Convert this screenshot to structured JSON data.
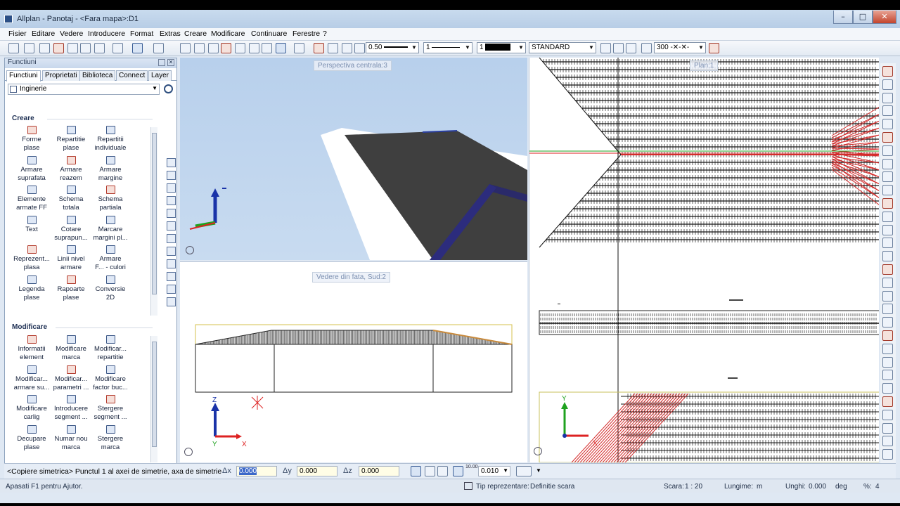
{
  "window": {
    "title": "Allplan - Panotaj - <Fara mapa>:D1",
    "controls": {
      "minimize": "–",
      "maximize": "□",
      "close": "✕"
    }
  },
  "menu": [
    "Fisier",
    "Editare",
    "Vedere",
    "Introducere",
    "Format",
    "Extras",
    "Creare",
    "Modificare",
    "Continuare",
    "Ferestre",
    "?"
  ],
  "toolbar": {
    "pen": "0.50",
    "line": "1",
    "color": "1",
    "layer": "STANDARD",
    "scale_pattern": "300 -✕-✕-"
  },
  "panel": {
    "title": "Functiuni",
    "tabs": [
      "Functiuni",
      "Proprietati",
      "Biblioteca",
      "Connect",
      "Layer"
    ],
    "active_tab": "Functiuni",
    "module": "Inginerie",
    "create_section": "Creare",
    "create_items": [
      [
        "Forme",
        "plase"
      ],
      [
        "Repartitie",
        "plase"
      ],
      [
        "Repartitii",
        "individuale"
      ],
      [
        "Armare",
        "suprafata"
      ],
      [
        "Armare",
        "reazem"
      ],
      [
        "Armare",
        "margine"
      ],
      [
        "Elemente",
        "armate FF"
      ],
      [
        "Schema",
        "totala"
      ],
      [
        "Schema",
        "partiala"
      ],
      [
        "Text",
        ""
      ],
      [
        "Cotare",
        "suprapun..."
      ],
      [
        "Marcare",
        "margini pl..."
      ],
      [
        "Reprezent...",
        "plasa"
      ],
      [
        "Linii nivel",
        "armare"
      ],
      [
        "Armare",
        "F... - culori"
      ],
      [
        "Legenda",
        "plase"
      ],
      [
        "Rapoarte",
        "plase"
      ],
      [
        "Conversie",
        "2D"
      ]
    ],
    "modify_section": "Modificare",
    "modify_items": [
      [
        "Informatii",
        "element"
      ],
      [
        "Modificare",
        "marca"
      ],
      [
        "Modificar...",
        "repartitie"
      ],
      [
        "Modificar...",
        "armare su..."
      ],
      [
        "Modificar...",
        "parametri ..."
      ],
      [
        "Modificare",
        "factor buc..."
      ],
      [
        "Modificare",
        "carlig"
      ],
      [
        "Introducere",
        "segment ..."
      ],
      [
        "Stergere",
        "segment ..."
      ],
      [
        "Decupare",
        "plase"
      ],
      [
        "Numar nou",
        "marca"
      ],
      [
        "Stergere",
        "marca"
      ]
    ]
  },
  "viewports": {
    "perspective_label": "Perspectiva centrala:3",
    "front_label": "Vedere din fata, Sud:2",
    "plan_label": "Plan:1",
    "axis_x": "X",
    "axis_y": "Y",
    "axis_z": "Z"
  },
  "commandline": {
    "prompt": "<Copiere simetrica> Punctul 1 al axei de simetrie, axa de simetrie",
    "dx_label": "Δx",
    "dx_value": "0.000",
    "dy_label": "Δy",
    "dy_value": "0.000",
    "dz_label": "Δz",
    "dz_value": "0.000",
    "angle_value": "0.010",
    "angle_tag": "10.00"
  },
  "statusbar": {
    "help": "Apasati F1 pentru Ajutor.",
    "representation_label": "Tip reprezentare:",
    "representation_value": "Definitie scara",
    "scale_label": "Scara:",
    "scale_value": "1 : 20",
    "length_label": "Lungime:",
    "length_unit": "m",
    "angle_label": "Unghi:",
    "angle_value": "0.000",
    "angle_unit": "deg",
    "percent_label": "%:",
    "percent_value": "4"
  },
  "colors": {
    "accent": "#3b5f97",
    "roof": "#3f3f3f",
    "rebar_red": "#d42a2a",
    "sky": "#b8d0ec"
  }
}
